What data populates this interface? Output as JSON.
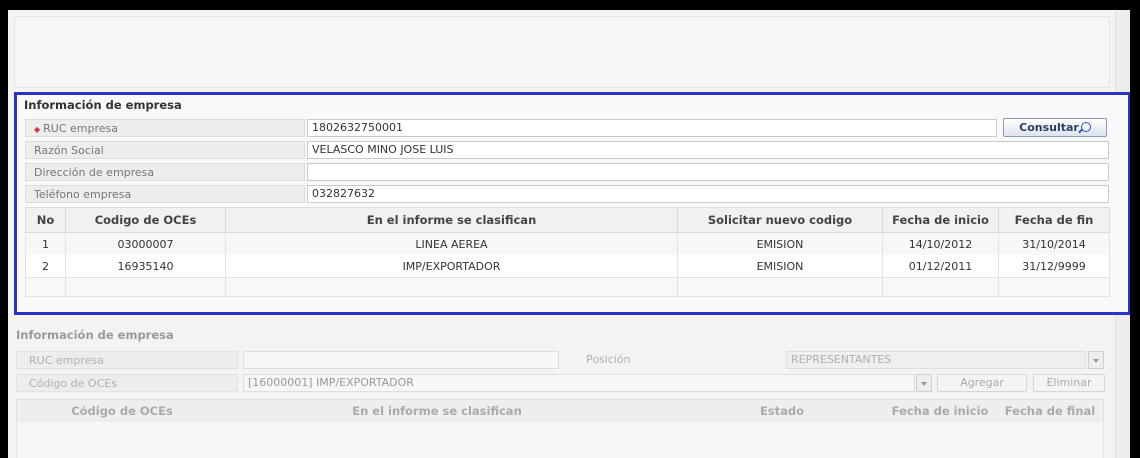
{
  "company_panel": {
    "title": "Información de empresa",
    "fields": [
      {
        "label": "RUC empresa",
        "value": "1802632750001",
        "required": true
      },
      {
        "label": "Razón Social",
        "value": "VELASCO MINO JOSE LUIS"
      },
      {
        "label": "Dirección de empresa",
        "value": ""
      },
      {
        "label": "Teléfono empresa",
        "value": "032827632"
      }
    ],
    "consult_button": "Consultar",
    "table": {
      "headers": [
        "No",
        "Codigo de OCEs",
        "En el informe se clasifican",
        "Solicitar nuevo codigo",
        "Fecha de inicio",
        "Fecha de fin"
      ],
      "rows": [
        [
          "1",
          "03000007",
          "LINEA AEREA",
          "EMISION",
          "14/10/2012",
          "31/10/2014"
        ],
        [
          "2",
          "16935140",
          "IMP/EXPORTADOR",
          "EMISION",
          "01/12/2011",
          "31/12/9999"
        ]
      ]
    }
  },
  "secondary_panel": {
    "title": "Información de empresa",
    "ruc_label": "RUC empresa",
    "ruc_value": "",
    "position_label": "Posición",
    "position_value": "REPRESENTANTES",
    "oce_label": "Código de OCEs",
    "oce_value": "[16000001] IMP/EXPORTADOR",
    "add_button": "Agregar",
    "remove_button": "Eliminar",
    "table_headers": [
      "Código de OCEs",
      "En el informe se clasifican",
      "Estado",
      "Fecha de inicio",
      "Fecha de final"
    ]
  },
  "colors": {
    "highlight_border": "#2b32c8",
    "required_marker": "#dd3333"
  }
}
